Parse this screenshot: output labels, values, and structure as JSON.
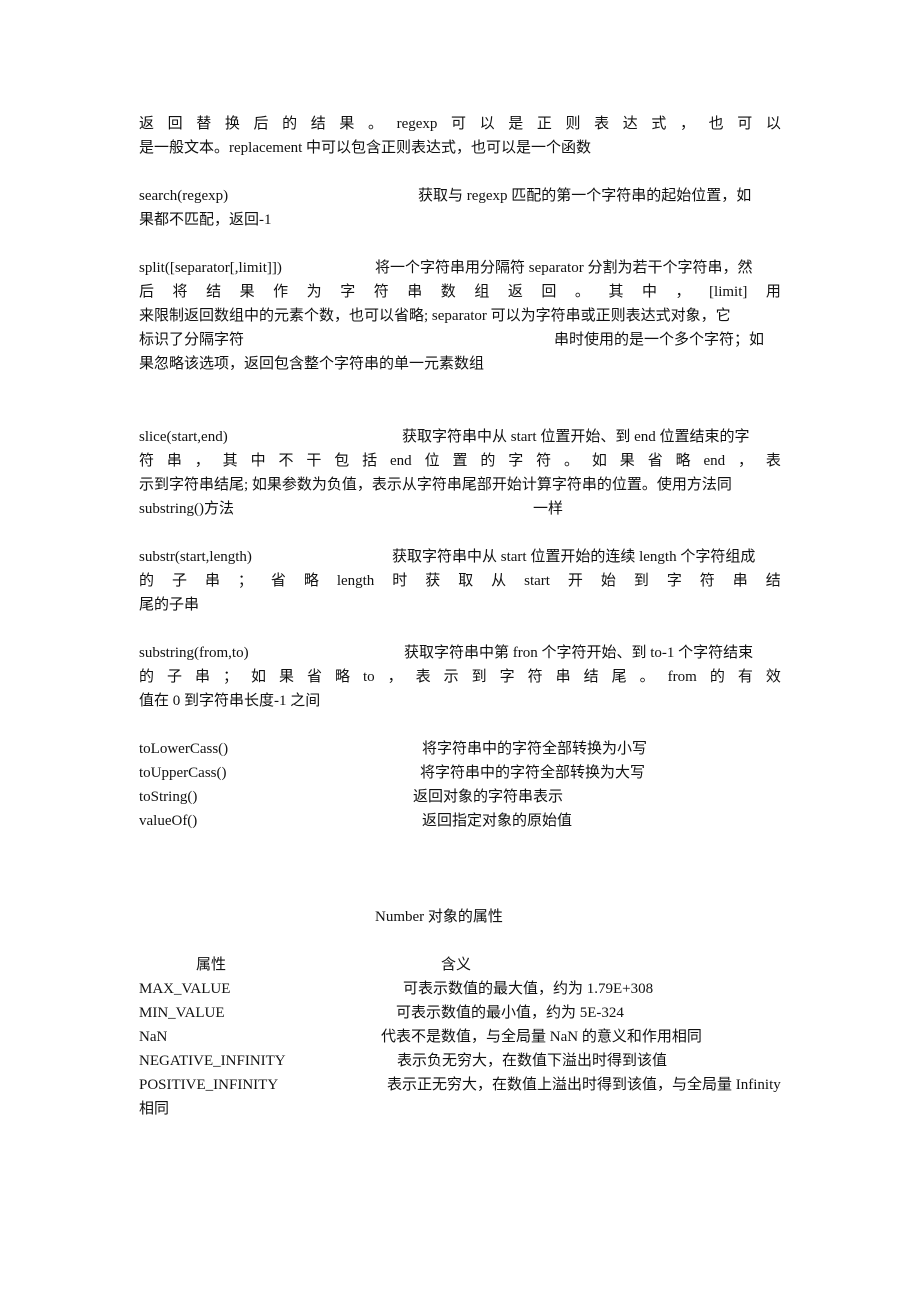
{
  "document": {
    "replace_tail": {
      "line1_tokens": [
        "返",
        "回",
        "替",
        "换",
        "后",
        "的",
        "结",
        "果",
        "。",
        "regexp",
        "可",
        "以",
        "是",
        "正",
        "则",
        "表",
        "达",
        "式",
        "，",
        "也",
        "可",
        "以"
      ],
      "line2": "是一般文本。replacement 中可以包含正则表达式，也可以是一个函数"
    },
    "search": {
      "name": "search(regexp)",
      "desc1": "获取与 regexp 匹配的第一个字符串的起始位置，如",
      "desc2": "果都不匹配，返回-1"
    },
    "split": {
      "name": "split([separator[,limit]])",
      "desc1": "将一个字符串用分隔符 separator 分割为若干个字符串，然",
      "line2_tokens": [
        "后",
        "将",
        "结",
        "果",
        "作",
        "为",
        "字",
        "符",
        "串",
        "数",
        "组",
        "返",
        "回",
        "。",
        "其",
        "中",
        "，",
        "[limit]",
        "用"
      ],
      "line3": "来限制返回数组中的元素个数，也可以省略; separator 可以为字符串或正则表达式对象，它",
      "line4a": "标识了分隔字符",
      "line4b": "串时使用的是一个多个字符；如",
      "line5": "果忽略该选项，返回包含整个字符串的单一元素数组"
    },
    "slice": {
      "name": "slice(start,end)",
      "desc1": "获取字符串中从 start 位置开始、到 end 位置结束的字",
      "line2_tokens": [
        "符",
        "串",
        "，",
        "其",
        "中",
        "不",
        "干",
        "包",
        "括",
        "end",
        "位",
        "置",
        "的",
        "字",
        "符",
        "。",
        "如",
        "果",
        "省",
        "略",
        "end",
        "，",
        "表"
      ],
      "line3": "示到字符串结尾; 如果参数为负值，表示从字符串尾部开始计算字符串的位置。使用方法同",
      "line4a": "substring()方法",
      "line4b": "一样"
    },
    "substr": {
      "name": "substr(start,length)",
      "desc1": "获取字符串中从 start 位置开始的连续 length 个字符组成",
      "line2_tokens": [
        "的",
        "子",
        "串",
        "；",
        "省",
        "略",
        "length",
        "时",
        "获",
        "取",
        "从",
        "start",
        "开",
        "始",
        "到",
        "字",
        "符",
        "串",
        "结"
      ],
      "line3": "尾的子串"
    },
    "substring": {
      "name": "substring(from,to)",
      "desc1": "获取字符串中第 fron 个字符开始、到 to-1 个字符结束",
      "line2_tokens": [
        "的",
        "子",
        "串",
        "；",
        "如",
        "果",
        "省",
        "略",
        "to",
        "，",
        "表",
        "示",
        "到",
        "字",
        "符",
        "串",
        "结",
        "尾",
        "。",
        "from",
        "的",
        "有",
        "效"
      ],
      "line3": "值在 0 到字符串长度-1 之间"
    },
    "simple_methods": [
      {
        "name": "toLowerCass()",
        "desc": "将字符串中的字符全部转换为小写"
      },
      {
        "name": "toUpperCass()",
        "desc": "将字符串中的字符全部转换为大写"
      },
      {
        "name": "toString()",
        "desc": "返回对象的字符串表示"
      },
      {
        "name": "valueOf()",
        "desc": "返回指定对象的原始值"
      }
    ],
    "number_section": {
      "title": "Number 对象的属性",
      "headers": {
        "property": "属性",
        "meaning": "含义"
      },
      "rows": [
        {
          "name": "MAX_VALUE",
          "desc": "可表示数值的最大值，约为 1.79E+308"
        },
        {
          "name": "MIN_VALUE",
          "desc": "可表示数值的最小值，约为 5E-324"
        },
        {
          "name": "NaN",
          "desc": "代表不是数值，与全局量 NaN 的意义和作用相同"
        },
        {
          "name": "NEGATIVE_INFINITY",
          "desc": "表示负无穷大，在数值下溢出时得到该值"
        },
        {
          "name": "POSITIVE_INFINITY",
          "desc": "表示正无穷大，在数值上溢出时得到该值，与全局量 Infinity"
        }
      ],
      "positive_infinity_wrap": "相同"
    }
  }
}
